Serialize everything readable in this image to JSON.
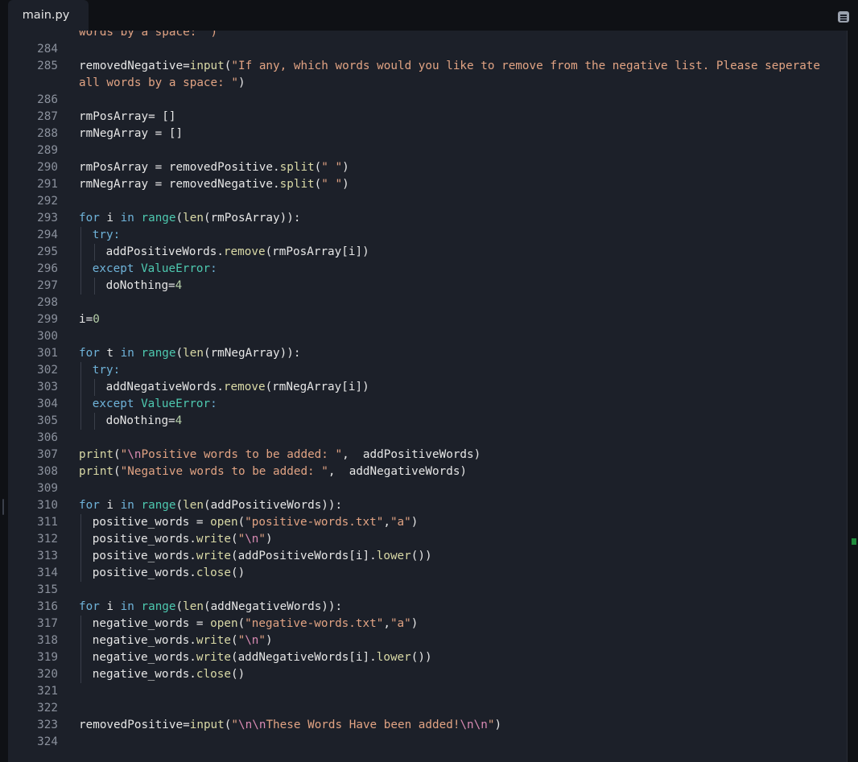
{
  "tab": {
    "filename": "main.py"
  },
  "colors": {
    "background": "#1c2029",
    "string": "#e1a383",
    "keyword": "#6fb3d9",
    "function": "#d9d9a6",
    "number": "#b5cea8",
    "class": "#4ec9b0",
    "escape": "#d98ab3",
    "line_number": "#8b919d",
    "change_marker": "#1f8a3b"
  },
  "lines": [
    {
      "num": "",
      "indent": 0,
      "tokens": [
        [
          "s",
          "words by a space: \")"
        ]
      ]
    },
    {
      "num": "284",
      "indent": 0,
      "tokens": []
    },
    {
      "num": "285",
      "indent": 0,
      "wrap": true,
      "tokens": [
        [
          "",
          "removedNegative="
        ],
        [
          "f",
          "input"
        ],
        [
          "",
          "("
        ],
        [
          "s",
          "\"If any, which words would you like to remove from the negative list. Please seperate all words by a space: \""
        ],
        [
          "",
          ")"
        ]
      ]
    },
    {
      "num": "286",
      "indent": 0,
      "tokens": []
    },
    {
      "num": "287",
      "indent": 0,
      "tokens": [
        [
          "",
          "rmPosArray= []"
        ]
      ]
    },
    {
      "num": "288",
      "indent": 0,
      "tokens": [
        [
          "",
          "rmNegArray = []"
        ]
      ]
    },
    {
      "num": "289",
      "indent": 0,
      "tokens": []
    },
    {
      "num": "290",
      "indent": 0,
      "tokens": [
        [
          "",
          "rmPosArray = removedPositive."
        ],
        [
          "f",
          "split"
        ],
        [
          "",
          "("
        ],
        [
          "s",
          "\" \""
        ],
        [
          "",
          ")"
        ]
      ]
    },
    {
      "num": "291",
      "indent": 0,
      "tokens": [
        [
          "",
          "rmNegArray = removedNegative."
        ],
        [
          "f",
          "split"
        ],
        [
          "",
          "("
        ],
        [
          "s",
          "\" \""
        ],
        [
          "",
          ")"
        ]
      ]
    },
    {
      "num": "292",
      "indent": 0,
      "tokens": []
    },
    {
      "num": "293",
      "indent": 0,
      "tokens": [
        [
          "k",
          "for"
        ],
        [
          "",
          " i "
        ],
        [
          "k",
          "in"
        ],
        [
          "",
          " "
        ],
        [
          "c",
          "range"
        ],
        [
          "",
          "("
        ],
        [
          "f",
          "len"
        ],
        [
          "",
          "(rmPosArray)):"
        ]
      ]
    },
    {
      "num": "294",
      "indent": 1,
      "tokens": [
        [
          "k",
          "try:"
        ]
      ]
    },
    {
      "num": "295",
      "indent": 2,
      "tokens": [
        [
          "",
          "addPositiveWords."
        ],
        [
          "f",
          "remove"
        ],
        [
          "",
          "(rmPosArray[i])"
        ]
      ]
    },
    {
      "num": "296",
      "indent": 1,
      "tokens": [
        [
          "k",
          "except"
        ],
        [
          "",
          " "
        ],
        [
          "c",
          "ValueError"
        ],
        [
          "k",
          ":"
        ]
      ]
    },
    {
      "num": "297",
      "indent": 2,
      "tokens": [
        [
          "",
          "doNothing="
        ],
        [
          "n",
          "4"
        ]
      ]
    },
    {
      "num": "298",
      "indent": 0,
      "tokens": []
    },
    {
      "num": "299",
      "indent": 0,
      "tokens": [
        [
          "",
          "i="
        ],
        [
          "n",
          "0"
        ]
      ]
    },
    {
      "num": "300",
      "indent": 0,
      "tokens": []
    },
    {
      "num": "301",
      "indent": 0,
      "tokens": [
        [
          "k",
          "for"
        ],
        [
          "",
          " t "
        ],
        [
          "k",
          "in"
        ],
        [
          "",
          " "
        ],
        [
          "c",
          "range"
        ],
        [
          "",
          "("
        ],
        [
          "f",
          "len"
        ],
        [
          "",
          "(rmNegArray)):"
        ]
      ]
    },
    {
      "num": "302",
      "indent": 1,
      "tokens": [
        [
          "k",
          "try:"
        ]
      ]
    },
    {
      "num": "303",
      "indent": 2,
      "tokens": [
        [
          "",
          "addNegativeWords."
        ],
        [
          "f",
          "remove"
        ],
        [
          "",
          "(rmNegArray[i])"
        ]
      ]
    },
    {
      "num": "304",
      "indent": 1,
      "tokens": [
        [
          "k",
          "except"
        ],
        [
          "",
          " "
        ],
        [
          "c",
          "ValueError"
        ],
        [
          "k",
          ":"
        ]
      ]
    },
    {
      "num": "305",
      "indent": 2,
      "tokens": [
        [
          "",
          "doNothing="
        ],
        [
          "n",
          "4"
        ]
      ]
    },
    {
      "num": "306",
      "indent": 0,
      "tokens": []
    },
    {
      "num": "307",
      "indent": 0,
      "tokens": [
        [
          "f",
          "print"
        ],
        [
          "",
          "("
        ],
        [
          "s",
          "\""
        ],
        [
          "e",
          "\\n"
        ],
        [
          "s",
          "Positive words to be added: \""
        ],
        [
          "",
          ",  addPositiveWords)"
        ]
      ]
    },
    {
      "num": "308",
      "indent": 0,
      "tokens": [
        [
          "f",
          "print"
        ],
        [
          "",
          "("
        ],
        [
          "s",
          "\"Negative words to be added: \""
        ],
        [
          "",
          ",  addNegativeWords)"
        ]
      ]
    },
    {
      "num": "309",
      "indent": 0,
      "tokens": []
    },
    {
      "num": "310",
      "indent": 0,
      "tokens": [
        [
          "k",
          "for"
        ],
        [
          "",
          " i "
        ],
        [
          "k",
          "in"
        ],
        [
          "",
          " "
        ],
        [
          "c",
          "range"
        ],
        [
          "",
          "("
        ],
        [
          "f",
          "len"
        ],
        [
          "",
          "(addPositiveWords)):"
        ]
      ]
    },
    {
      "num": "311",
      "indent": 1,
      "tokens": [
        [
          "",
          "positive_words = "
        ],
        [
          "f",
          "open"
        ],
        [
          "",
          "("
        ],
        [
          "s",
          "\"positive-words.txt\""
        ],
        [
          "",
          ","
        ],
        [
          "s",
          "\"a\""
        ],
        [
          "",
          ")"
        ]
      ]
    },
    {
      "num": "312",
      "indent": 1,
      "tokens": [
        [
          "",
          "positive_words."
        ],
        [
          "f",
          "write"
        ],
        [
          "",
          "("
        ],
        [
          "s",
          "\""
        ],
        [
          "e",
          "\\n"
        ],
        [
          "s",
          "\""
        ],
        [
          "",
          ")"
        ]
      ]
    },
    {
      "num": "313",
      "indent": 1,
      "tokens": [
        [
          "",
          "positive_words."
        ],
        [
          "f",
          "write"
        ],
        [
          "",
          "(addPositiveWords[i]."
        ],
        [
          "f",
          "lower"
        ],
        [
          "",
          "())"
        ]
      ]
    },
    {
      "num": "314",
      "indent": 1,
      "tokens": [
        [
          "",
          "positive_words."
        ],
        [
          "f",
          "close"
        ],
        [
          "",
          "()"
        ]
      ]
    },
    {
      "num": "315",
      "indent": 0,
      "tokens": []
    },
    {
      "num": "316",
      "indent": 0,
      "tokens": [
        [
          "k",
          "for"
        ],
        [
          "",
          " i "
        ],
        [
          "k",
          "in"
        ],
        [
          "",
          " "
        ],
        [
          "c",
          "range"
        ],
        [
          "",
          "("
        ],
        [
          "f",
          "len"
        ],
        [
          "",
          "(addNegativeWords)):"
        ]
      ]
    },
    {
      "num": "317",
      "indent": 1,
      "tokens": [
        [
          "",
          "negative_words = "
        ],
        [
          "f",
          "open"
        ],
        [
          "",
          "("
        ],
        [
          "s",
          "\"negative-words.txt\""
        ],
        [
          "",
          ","
        ],
        [
          "s",
          "\"a\""
        ],
        [
          "",
          ")"
        ]
      ]
    },
    {
      "num": "318",
      "indent": 1,
      "tokens": [
        [
          "",
          "negative_words."
        ],
        [
          "f",
          "write"
        ],
        [
          "",
          "("
        ],
        [
          "s",
          "\""
        ],
        [
          "e",
          "\\n"
        ],
        [
          "s",
          "\""
        ],
        [
          "",
          ")"
        ]
      ]
    },
    {
      "num": "319",
      "indent": 1,
      "tokens": [
        [
          "",
          "negative_words."
        ],
        [
          "f",
          "write"
        ],
        [
          "",
          "(addNegativeWords[i]."
        ],
        [
          "f",
          "lower"
        ],
        [
          "",
          "())"
        ]
      ]
    },
    {
      "num": "320",
      "indent": 1,
      "tokens": [
        [
          "",
          "negative_words."
        ],
        [
          "f",
          "close"
        ],
        [
          "",
          "()"
        ]
      ]
    },
    {
      "num": "321",
      "indent": 0,
      "tokens": []
    },
    {
      "num": "322",
      "indent": 0,
      "tokens": []
    },
    {
      "num": "323",
      "indent": 0,
      "tokens": [
        [
          "",
          "removedPositive="
        ],
        [
          "f",
          "input"
        ],
        [
          "",
          "("
        ],
        [
          "s",
          "\""
        ],
        [
          "e",
          "\\n\\n"
        ],
        [
          "s",
          "These Words Have been added!"
        ],
        [
          "e",
          "\\n\\n"
        ],
        [
          "s",
          "\""
        ],
        [
          "",
          ")"
        ]
      ]
    },
    {
      "num": "324",
      "indent": 0,
      "tokens": []
    }
  ]
}
